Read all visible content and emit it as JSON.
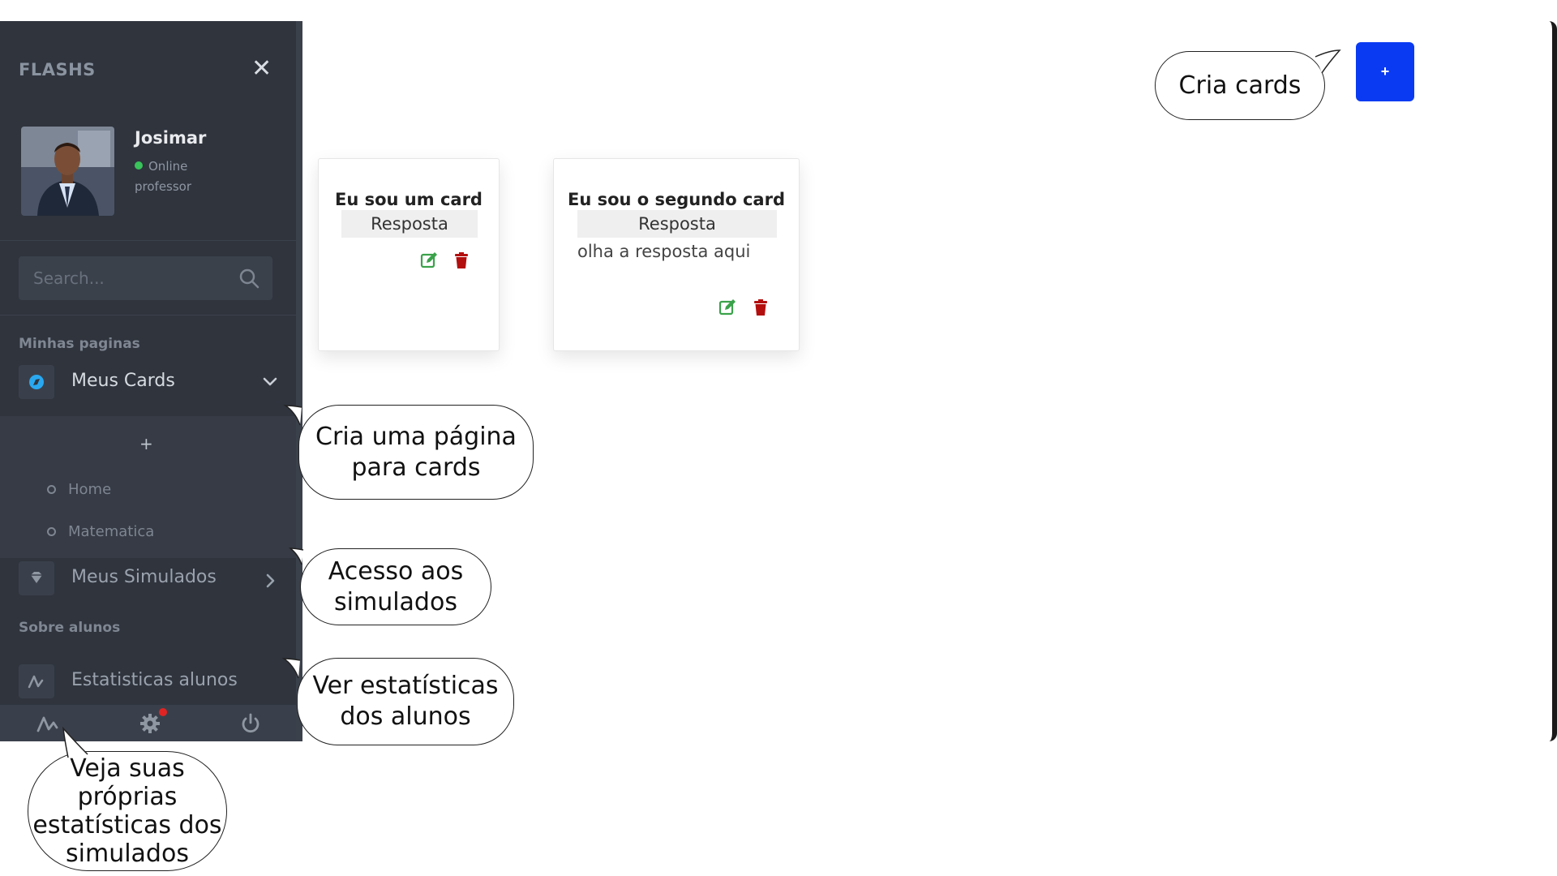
{
  "sidebar": {
    "brand": "FLASHS",
    "user": {
      "name": "Josimar",
      "status": "Online",
      "role": "professor"
    },
    "search": {
      "placeholder": "Search..."
    },
    "sections": [
      {
        "label": "Minhas paginas"
      },
      {
        "label": "Sobre alunos"
      }
    ],
    "items": [
      {
        "label": "Meus Cards"
      },
      {
        "label": "Meus Simulados"
      },
      {
        "label": "Estatisticas alunos"
      }
    ],
    "submenu": {
      "add_label": "+",
      "items": [
        {
          "label": "Home"
        },
        {
          "label": "Matematica"
        }
      ]
    },
    "footer_icons": [
      "activity-icon",
      "gear-icon",
      "power-icon"
    ]
  },
  "main": {
    "add_button_label": "+",
    "cards": [
      {
        "title": "Eu sou um card",
        "answer_label": "Resposta",
        "answer": ""
      },
      {
        "title": "Eu sou o segundo card",
        "answer_label": "Resposta",
        "answer": "olha a resposta aqui"
      }
    ]
  },
  "annotations": {
    "create_cards": "Cria cards",
    "create_page": [
      "Cria uma página",
      "para cards"
    ],
    "access_simulados": [
      "Acesso aos",
      "simulados"
    ],
    "view_stats": [
      "Ver estatísticas",
      "dos alunos"
    ],
    "own_stats": [
      "Veja suas",
      "próprias",
      "estatísticas dos",
      "simulados"
    ]
  },
  "colors": {
    "sidebar_bg": "#2f343d",
    "accent_blue": "#0a3bf2",
    "edit_green": "#3aa24a",
    "delete_red": "#b30f0f",
    "online_green": "#39c35a"
  }
}
